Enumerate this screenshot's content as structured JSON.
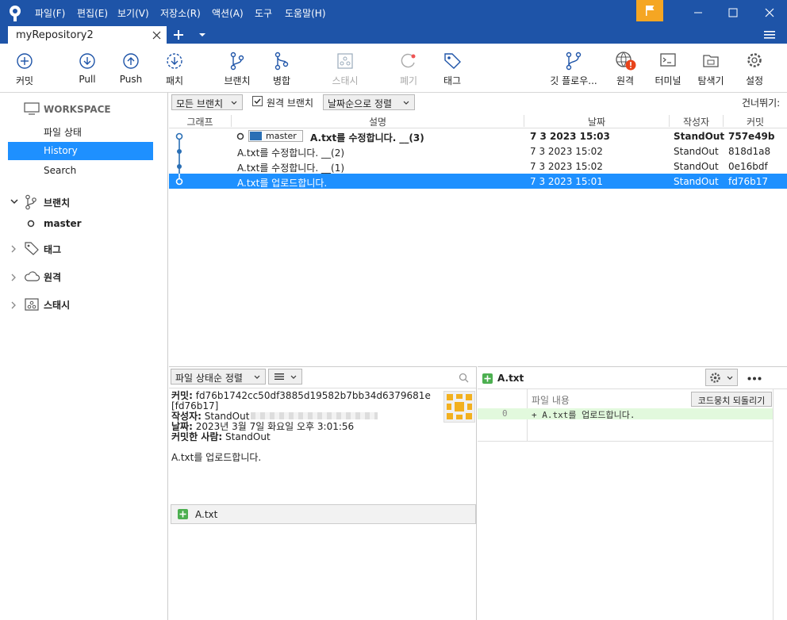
{
  "menu": {
    "items": [
      "파일(F)",
      "편집(E)",
      "보기(V)",
      "저장소(R)",
      "액션(A)",
      "도구",
      "도움말(H)"
    ]
  },
  "tab": {
    "title": "myRepository2"
  },
  "toolbar": {
    "commit": "커밋",
    "pull": "Pull",
    "push": "Push",
    "fetch": "패치",
    "branch": "브랜치",
    "merge": "병합",
    "stash": "스태시",
    "discard": "폐기",
    "tag": "태그",
    "gitflow": "깃 플로우...",
    "remote": "원격",
    "terminal": "터미널",
    "explorer": "탐색기",
    "settings": "설정"
  },
  "sidebar": {
    "workspace": "WORKSPACE",
    "file_status": "파일 상태",
    "history": "History",
    "search": "Search",
    "branches": "브랜치",
    "master": "master",
    "tags": "태그",
    "remotes": "원격",
    "stashes": "스태시"
  },
  "filters": {
    "all_branches": "모든 브랜치",
    "remote_branches": "원격 브랜치",
    "sort": "날짜순으로 정렬",
    "skip": "건너뛰기:"
  },
  "columns": {
    "graph": "그래프",
    "desc": "설명",
    "date": "날짜",
    "author": "작성자",
    "commit": "커밋"
  },
  "commits": [
    {
      "desc": "A.txt를 수정합니다. __(3)",
      "date": "7 3 2023 15:03",
      "author": "StandOut",
      "hash": "757e49b",
      "branch": "master"
    },
    {
      "desc": "A.txt를 수정합니다. __(2)",
      "date": "7 3 2023 15:02",
      "author": "StandOut",
      "hash": "818d1a8"
    },
    {
      "desc": "A.txt를 수정합니다. __(1)",
      "date": "7 3 2023 15:02",
      "author": "StandOut",
      "hash": "0e16bdf"
    },
    {
      "desc": "A.txt를 업로드합니다.",
      "date": "7 3 2023 15:01",
      "author": "StandOut",
      "hash": "fd76b17"
    }
  ],
  "details": {
    "sort": "파일 상태순 정렬",
    "commit_label": "커밋:",
    "commit_full": "fd76b1742cc50df3885d19582b7bb34d6379681e",
    "commit_short": "[fd76b17]",
    "author_label": "작성자:",
    "author": "StandOut",
    "date_label": "날짜:",
    "date": "2023년 3월 7일 화요일 오후 3:01:56",
    "committer_label": "커밋한 사람:",
    "committer": "StandOut",
    "message": "A.txt를 업로드합니다.",
    "file": "A.txt"
  },
  "diff": {
    "file": "A.txt",
    "header": "파일 내용",
    "revert": "코드뭉치 되돌리기",
    "line_no": "0",
    "line": "+ A.txt를 업로드합니다."
  },
  "colors": {
    "accent": "#1e54a8",
    "selection": "#1e90ff",
    "flag": "#f5a623",
    "added": "#4caf50"
  }
}
